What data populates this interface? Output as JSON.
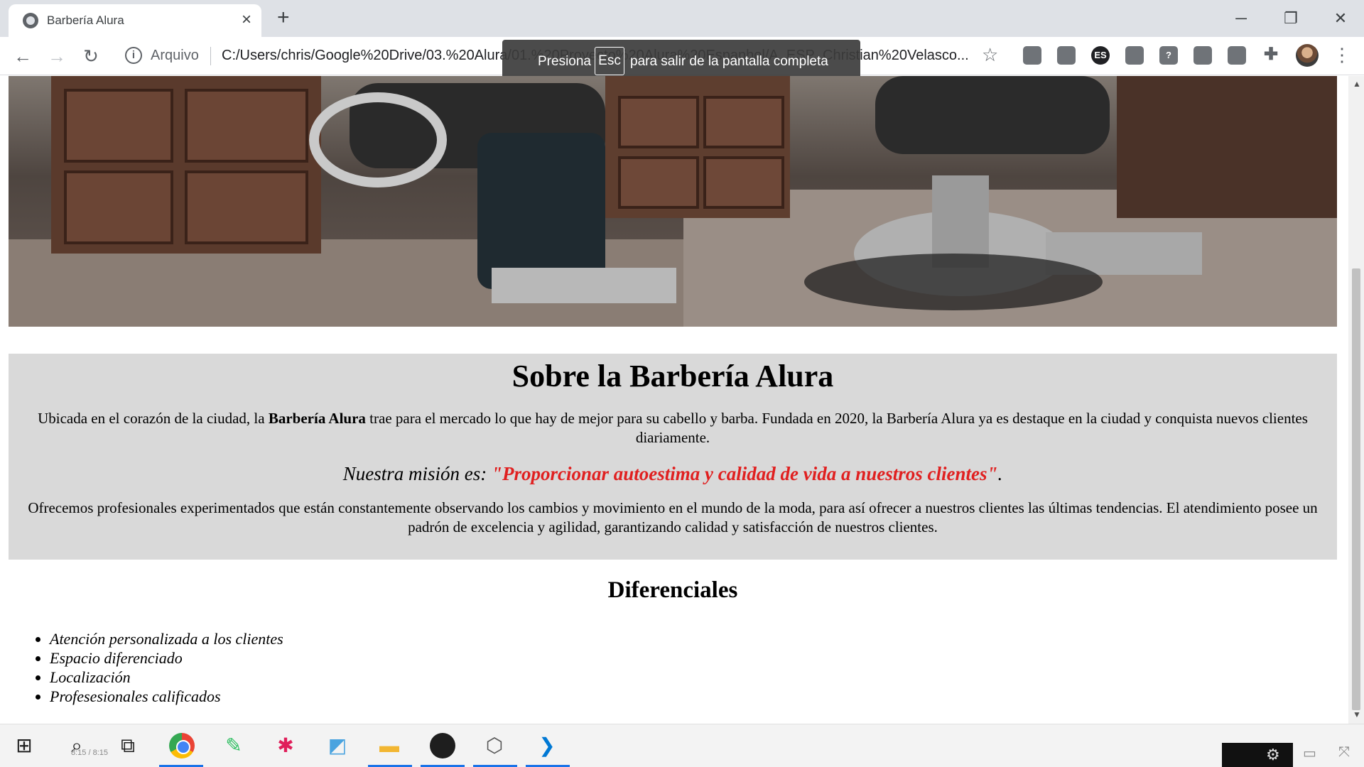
{
  "browser": {
    "tab_title": "Barbería Alura",
    "new_tab_label": "+",
    "address_scheme": "Arquivo",
    "address_url": "C:/Users/chris/Google%20Drive/03.%20Alura/01.%20Proyecto%20Alura%20Espanhol/A_ESP_Christian%20Velasco...",
    "fullscreen_hint": {
      "before": "Presiona",
      "key": "Esc",
      "after": "para salir de la pantalla completa"
    },
    "extension_es": "ES"
  },
  "page": {
    "about_title": "Sobre la Barbería Alura",
    "about_p1_start": "Ubicada en el corazón de la ciudad, la ",
    "about_p1_bold": "Barbería Alura",
    "about_p1_end": " trae para el mercado lo que hay de mejor para su cabello y barba. Fundada en 2020, la Barbería Alura ya es destaque en la ciudad y conquista nuevos clientes diariamente.",
    "mission_label": "Nuestra misión es: ",
    "mission_quote": "\"Proporcionar autoestima y calidad de vida a nuestros clientes\"",
    "mission_end": ".",
    "about_p2": "Ofrecemos profesionales experimentados que están constantemente observando los cambios y movimiento en el mundo de la moda, para así ofrecer a nuestros clientes las últimas tendencias. El atendimiento posee un padrón de excelencia y agilidad, garantizando calidad y satisfacción de nuestros clientes.",
    "diferenciales_title": "Diferenciales",
    "diferenciales": [
      "Atención personalizada a los clientes",
      "Espacio diferenciado",
      "Localización",
      "Profesesionales calificados"
    ]
  },
  "taskbar": {
    "media_time": "8:15 / 8:15"
  },
  "colors": {
    "mission_highlight": "#e02020",
    "section_bg": "#d9d9d9",
    "taskbar_active": "#1a73e8"
  }
}
